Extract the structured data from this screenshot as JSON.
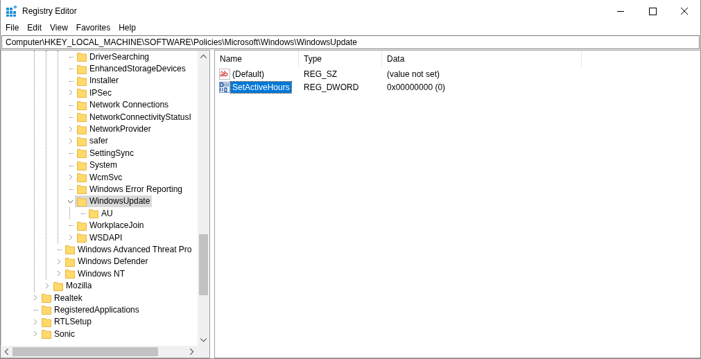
{
  "window": {
    "title": "Registry Editor"
  },
  "menu": [
    "File",
    "Edit",
    "View",
    "Favorites",
    "Help"
  ],
  "address": "Computer\\HKEY_LOCAL_MACHINE\\SOFTWARE\\Policies\\Microsoft\\Windows\\WindowsUpdate",
  "tree": {
    "items": [
      {
        "children": [
          {
            "children": [
              {
                "children": [
                  {
                    "label": "DriverSearching",
                    "has_children": false,
                    "selected": false
                  },
                  {
                    "label": "EnhancedStorageDevices",
                    "has_children": false,
                    "selected": false
                  },
                  {
                    "label": "Installer",
                    "has_children": false,
                    "selected": false
                  },
                  {
                    "label": "IPSec",
                    "has_children": true,
                    "expanded": false,
                    "selected": false
                  },
                  {
                    "label": "Network Connections",
                    "has_children": false,
                    "selected": false
                  },
                  {
                    "label": "NetworkConnectivityStatusI",
                    "has_children": false,
                    "selected": false
                  },
                  {
                    "label": "NetworkProvider",
                    "has_children": true,
                    "expanded": false,
                    "selected": false
                  },
                  {
                    "label": "safer",
                    "has_children": true,
                    "expanded": false,
                    "selected": false
                  },
                  {
                    "label": "SettingSync",
                    "has_children": false,
                    "selected": false
                  },
                  {
                    "label": "System",
                    "has_children": false,
                    "selected": false
                  },
                  {
                    "label": "WcmSvc",
                    "has_children": true,
                    "expanded": false,
                    "selected": false
                  },
                  {
                    "label": "Windows Error Reporting",
                    "has_children": false,
                    "selected": false
                  },
                  {
                    "label": "WindowsUpdate",
                    "has_children": true,
                    "expanded": true,
                    "selected": true,
                    "children": [
                      {
                        "label": "AU",
                        "has_children": false,
                        "selected": false
                      }
                    ]
                  },
                  {
                    "label": "WorkplaceJoin",
                    "has_children": false,
                    "selected": false
                  },
                  {
                    "label": "WSDAPI",
                    "has_children": true,
                    "expanded": false,
                    "selected": false
                  }
                ]
              },
              {
                "label": "Windows Advanced Threat Pro",
                "has_children": false,
                "selected": false
              },
              {
                "label": "Windows Defender",
                "has_children": true,
                "expanded": false,
                "selected": false
              },
              {
                "label": "Windows NT",
                "has_children": true,
                "expanded": false,
                "selected": false
              }
            ]
          },
          {
            "label": "Mozilla",
            "has_children": true,
            "expanded": false,
            "selected": false
          }
        ]
      },
      {
        "label": "Realtek",
        "has_children": true,
        "expanded": false,
        "selected": false
      },
      {
        "label": "RegisteredApplications",
        "has_children": false,
        "selected": false
      },
      {
        "label": "RTLSetup",
        "has_children": true,
        "expanded": false,
        "selected": false
      },
      {
        "label": "Sonic",
        "has_children": true,
        "expanded": false,
        "selected": false
      }
    ]
  },
  "values": {
    "columns": [
      "Name",
      "Type",
      "Data"
    ],
    "rows": [
      {
        "kind": "string",
        "name": "(Default)",
        "type": "REG_SZ",
        "data": "(value not set)",
        "selected": false
      },
      {
        "kind": "binary",
        "name": "SetActiveHours",
        "type": "REG_DWORD",
        "data": "0x00000000 (0)",
        "selected": true
      }
    ]
  }
}
